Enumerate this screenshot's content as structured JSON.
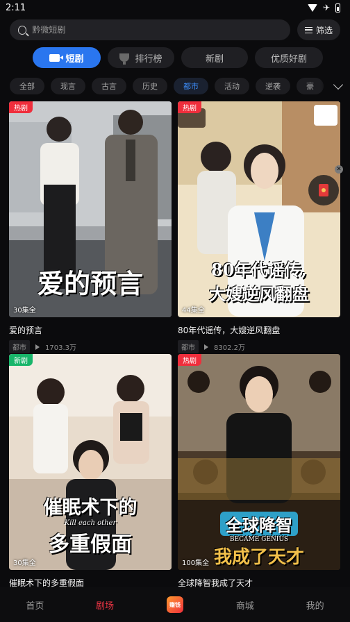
{
  "status_bar": {
    "time": "2:11"
  },
  "search": {
    "placeholder": "黔微短剧",
    "filter_label": "筛选"
  },
  "top_tabs": [
    {
      "label": "短剧",
      "active": true
    },
    {
      "label": "排行榜",
      "active": false
    },
    {
      "label": "新剧",
      "active": false
    },
    {
      "label": "优质好剧",
      "active": false
    }
  ],
  "genres": [
    "全部",
    "现言",
    "古言",
    "历史",
    "都市",
    "活动",
    "逆袭",
    "豪"
  ],
  "active_genre": "都市",
  "cards": [
    {
      "title": "爱的预言",
      "badge": "热剧",
      "episodes": "30集全",
      "tag": "都市",
      "plays": "1703.3万",
      "poster_text": "爱的预言"
    },
    {
      "title": "80年代谣传，大嫂逆风翻盘",
      "badge": "热剧",
      "episodes": "44集全",
      "tag": "都市",
      "plays": "8302.2万",
      "poster_text_1": "80年代谣传,",
      "poster_text_2": "大嫂逆风翻盘"
    },
    {
      "title": "催眠术下的多重假面",
      "badge": "新剧",
      "episodes": "30集全",
      "poster_text_1": "催眠术下的",
      "poster_sub": "Kill each other",
      "poster_text_2": "多重假面"
    },
    {
      "title": "全球降智我成了天才",
      "badge": "热剧",
      "episodes": "100集全",
      "poster_text_1": "全球降智",
      "poster_sub": "BECAME GENIUS",
      "poster_text_2": "我成了天才"
    }
  ],
  "bottom_nav": [
    {
      "label": "首页",
      "active": false
    },
    {
      "label": "剧场",
      "active": true
    },
    {
      "label": "赚钱",
      "active": false
    },
    {
      "label": "商城",
      "active": false
    },
    {
      "label": "我的",
      "active": false
    }
  ],
  "colors": {
    "accent_blue": "#2a76ef",
    "hot_red": "#ef2e3c",
    "new_green": "#18b56a"
  }
}
